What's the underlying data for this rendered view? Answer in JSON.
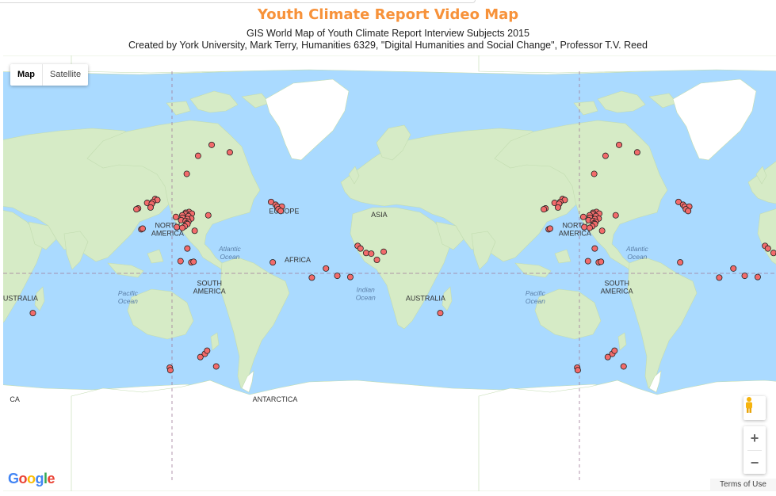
{
  "header": {
    "title": "Youth Climate Report Video Map",
    "subtitle_line1": "GIS World Map of Youth Climate Report Interview Subjects 2015",
    "subtitle_line2": "Created by York University, Mark Terry, Humanities 6329, \"Digital Humanities and Social Change\", Professor T.V. Reed"
  },
  "map_controls": {
    "map_label": "Map",
    "satellite_label": "Satellite",
    "active_type": "Map",
    "zoom_in": "+",
    "zoom_out": "−",
    "pegman": "street-view-pegman-icon",
    "terms": "Terms of Use"
  },
  "branding": {
    "logo_text": "Google",
    "logo_colors": [
      "#4285f4",
      "#ea4335",
      "#fbbc05",
      "#4285f4",
      "#34a853",
      "#ea4335"
    ]
  },
  "colors": {
    "ocean": "#aadaff",
    "land": "#d6ebc6",
    "ice": "#ffffff",
    "marker_fill": "#f26b6b",
    "marker_stroke": "#222222",
    "title": "#f7923a"
  },
  "map_labels": [
    {
      "text": "ASIA",
      "kind": "continent"
    },
    {
      "text": "NORTH AMERICA",
      "kind": "continent"
    },
    {
      "text": "EUROPE",
      "kind": "continent"
    },
    {
      "text": "ASIA",
      "kind": "continent"
    },
    {
      "text": "NORTH AMERICA",
      "kind": "continent"
    },
    {
      "text": "Atlantic Ocean",
      "kind": "ocean"
    },
    {
      "text": "AFRICA",
      "kind": "continent"
    },
    {
      "text": "Atlantic Ocean",
      "kind": "ocean"
    },
    {
      "text": "Indian Ocean",
      "kind": "ocean"
    },
    {
      "text": "AUSTRALIA",
      "kind": "continent"
    },
    {
      "text": "Pacific Ocean",
      "kind": "ocean"
    },
    {
      "text": "SOUTH AMERICA",
      "kind": "continent"
    },
    {
      "text": "Indian Ocean",
      "kind": "ocean"
    },
    {
      "text": "AUSTRALIA",
      "kind": "continent"
    },
    {
      "text": "Pacific Ocean",
      "kind": "ocean"
    },
    {
      "text": "SOUTH AMERICA",
      "kind": "continent"
    },
    {
      "text": "ANTARCTICA",
      "kind": "continent"
    },
    {
      "text": "CA",
      "kind": "continent"
    }
  ],
  "markers": [
    {
      "lat": 72.0,
      "lon": -56.0
    },
    {
      "lat": 70.0,
      "lon": -40.0
    },
    {
      "lat": 69.0,
      "lon": -68.0
    },
    {
      "lat": 63.0,
      "lon": -78.0
    },
    {
      "lat": 52.0,
      "lon": -106.0
    },
    {
      "lat": 51.5,
      "lon": -104.0
    },
    {
      "lat": 50.5,
      "lon": -108.0
    },
    {
      "lat": 50.0,
      "lon": -113.0
    },
    {
      "lat": 49.5,
      "lon": -109.0
    },
    {
      "lat": 47.5,
      "lon": -110.0
    },
    {
      "lat": 47.0,
      "lon": -121.0
    },
    {
      "lat": 46.5,
      "lon": -122.5
    },
    {
      "lat": 45.0,
      "lon": -76.0
    },
    {
      "lat": 44.5,
      "lon": -79.0
    },
    {
      "lat": 44.0,
      "lon": -73.5
    },
    {
      "lat": 43.7,
      "lon": -79.4
    },
    {
      "lat": 43.0,
      "lon": -82.0
    },
    {
      "lat": 42.5,
      "lon": -76.5
    },
    {
      "lat": 42.0,
      "lon": -87.6
    },
    {
      "lat": 41.5,
      "lon": -81.7
    },
    {
      "lat": 41.0,
      "lon": -74.0
    },
    {
      "lat": 40.7,
      "lon": -77.5
    },
    {
      "lat": 40.0,
      "lon": -83.0
    },
    {
      "lat": 39.5,
      "lon": -79.0
    },
    {
      "lat": 39.0,
      "lon": -76.6
    },
    {
      "lat": 38.0,
      "lon": -78.0
    },
    {
      "lat": 37.5,
      "lon": -77.4
    },
    {
      "lat": 36.0,
      "lon": -79.8
    },
    {
      "lat": 35.5,
      "lon": -86.8
    },
    {
      "lat": 35.0,
      "lon": -82.0
    },
    {
      "lat": 34.0,
      "lon": -118.2
    },
    {
      "lat": 34.5,
      "lon": -117.0
    },
    {
      "lat": 33.0,
      "lon": -71.0
    },
    {
      "lat": 43.0,
      "lon": -59.0
    },
    {
      "lat": 20.0,
      "lon": -77.5
    },
    {
      "lat": 10.0,
      "lon": -83.5
    },
    {
      "lat": 9.0,
      "lon": -74.0
    },
    {
      "lat": 9.5,
      "lon": -72.0
    },
    {
      "lat": 50.5,
      "lon": -3.5
    },
    {
      "lat": 49.0,
      "lon": 0.5
    },
    {
      "lat": 48.0,
      "lon": 2.0
    },
    {
      "lat": 48.0,
      "lon": 6.0
    },
    {
      "lat": 46.5,
      "lon": 3.0
    },
    {
      "lat": 45.5,
      "lon": 5.0
    },
    {
      "lat": 22.0,
      "lon": 73.0
    },
    {
      "lat": 20.0,
      "lon": 75.5
    },
    {
      "lat": 16.5,
      "lon": 80.5
    },
    {
      "lat": 16.0,
      "lon": 85.0
    },
    {
      "lat": 17.5,
      "lon": 96.0
    },
    {
      "lat": 11.0,
      "lon": 90.0
    },
    {
      "lat": 4.0,
      "lon": 45.0
    },
    {
      "lat": -2.0,
      "lon": 55.0
    },
    {
      "lat": -3.0,
      "lon": 66.5
    },
    {
      "lat": 9.0,
      "lon": -2.0
    },
    {
      "lat": -3.5,
      "lon": 32.5
    },
    {
      "lat": -31.0,
      "lon": 146.0
    },
    {
      "lat": -55.0,
      "lon": -62.0
    },
    {
      "lat": -53.5,
      "lon": -60.0
    },
    {
      "lat": -56.5,
      "lon": -66.0
    },
    {
      "lat": -60.5,
      "lon": -52.0
    },
    {
      "lat": -61.0,
      "lon": -93.0
    },
    {
      "lat": -62.0,
      "lon": -92.5
    }
  ]
}
